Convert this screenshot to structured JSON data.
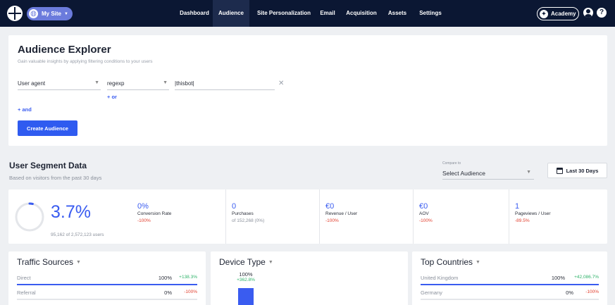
{
  "nav": {
    "site_label": "My Site",
    "items": [
      "Dashboard",
      "Audience",
      "Site Personalization",
      "Email",
      "Acquisition",
      "Assets",
      "Settings"
    ],
    "active": "Audience",
    "academy_label": "Academy"
  },
  "explorer": {
    "title": "Audience Explorer",
    "subtitle": "Gain valuable insights by applying filtering conditions to your users",
    "condition": {
      "attribute": "User agent",
      "operator": "regexp",
      "value": "|thisbot|"
    },
    "or_label": "+ or",
    "and_label": "+ and",
    "create_label": "Create Audience"
  },
  "segment": {
    "title": "User Segment Data",
    "subtitle": "Based on visitors from the past 30 days",
    "compare_label": "Compare to",
    "compare_value": "Select Audience",
    "date_label": "Last 30 Days"
  },
  "stats": {
    "main_pct": "3.7%",
    "main_fraction": 0.037,
    "users_note": "95,162 of 2,572,123 users",
    "items": [
      {
        "value": "0%",
        "label": "Conversion Rate",
        "change": "-100%"
      },
      {
        "value": "0",
        "label": "Purchases",
        "note": "of 152,268 (0%)"
      },
      {
        "value": "€0",
        "label": "Revenue / User",
        "change": "-100%"
      },
      {
        "value": "€0",
        "label": "AOV",
        "change": "-100%"
      },
      {
        "value": "1",
        "label": "Pageviews / User",
        "change": "-89.5%"
      }
    ]
  },
  "traffic": {
    "title": "Traffic Sources",
    "rows": [
      {
        "name": "Direct",
        "pct": "100%",
        "change": "+138.3%",
        "fill": 1.0
      },
      {
        "name": "Referral",
        "pct": "0%",
        "change": "-100%",
        "fill": 0
      }
    ]
  },
  "device": {
    "title": "Device Type",
    "pct": "100%",
    "change": "+362.8%"
  },
  "countries": {
    "title": "Top Countries",
    "rows": [
      {
        "name": "United Kingdom",
        "pct": "100%",
        "change": "+42,086.7%",
        "fill": 1.0
      },
      {
        "name": "Germany",
        "pct": "0%",
        "change": "-100%",
        "fill": 0
      }
    ]
  },
  "colors": {
    "nav_bg": "#0b1733",
    "accent": "#3a5cf0",
    "positive": "#2fb36a",
    "negative": "#e2402f"
  }
}
